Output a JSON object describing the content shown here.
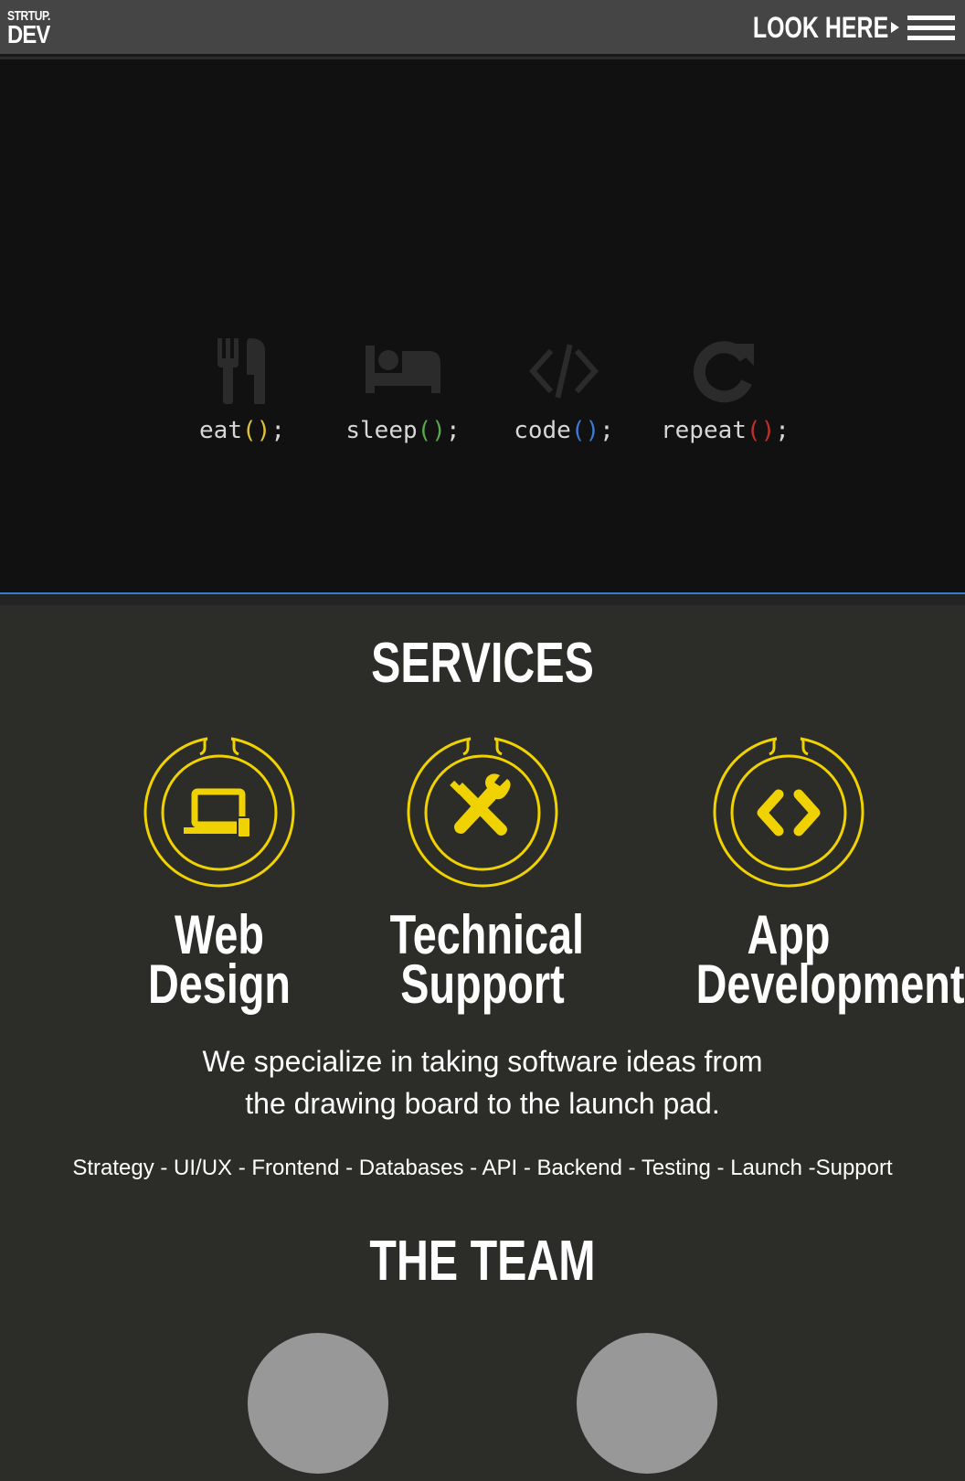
{
  "header": {
    "logo_line1": "STRTUP.",
    "logo_line2": "DEV",
    "look_label": "LOOK HERE",
    "menu_icon": "hamburger-icon"
  },
  "hero": {
    "routines": [
      {
        "word": "eat",
        "parens": "()",
        "semi": ";",
        "icon": "fork-knife-icon",
        "paren_color": "#e0c23a"
      },
      {
        "word": "sleep",
        "parens": "()",
        "semi": ";",
        "icon": "bed-icon",
        "paren_color": "#5aa84a"
      },
      {
        "word": "code",
        "parens": "()",
        "semi": ";",
        "icon": "code-icon",
        "paren_color": "#3a7bd5"
      },
      {
        "word": "repeat",
        "parens": "()",
        "semi": ";",
        "icon": "repeat-icon",
        "paren_color": "#c0302a"
      }
    ]
  },
  "services": {
    "title": "SERVICES",
    "items": [
      {
        "line1": "Web",
        "line2": "Design",
        "icon": "laptop-icon"
      },
      {
        "line1": "Technical",
        "line2": "Support",
        "icon": "tools-icon"
      },
      {
        "line1": "App",
        "line2": "Development",
        "icon": "code-brackets-icon"
      }
    ],
    "desc_line1": "We specialize in taking software ideas from",
    "desc_line2": "the drawing board to the launch pad.",
    "skills": "Strategy - UI/UX - Frontend - Databases - API - Backend - Testing - Launch -Support"
  },
  "team": {
    "title": "THE TEAM"
  },
  "colors": {
    "accent_yellow": "#f0d200",
    "hero_bg": "#111111",
    "section_bg": "#2c2c28",
    "avatar": "#989898"
  }
}
